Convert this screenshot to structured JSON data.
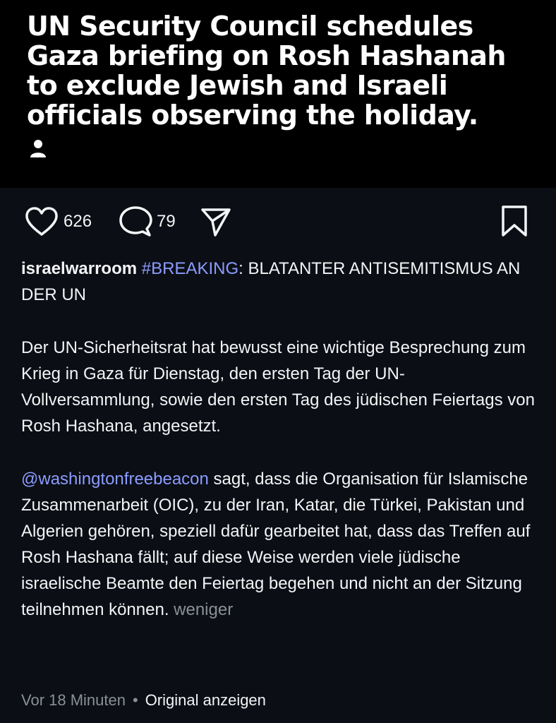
{
  "image": {
    "headline": "UN Security Council schedules Gaza briefing on Rosh Hashanah to exclude Jewish and Israeli officials observing the holiday."
  },
  "actions": {
    "likes": "626",
    "comments": "79"
  },
  "post": {
    "username": "israelwarroom",
    "hashtag": "#BREAKING",
    "headline_rest": ": BLATANTER ANTISEMITISMUS AN DER UN",
    "paragraph1": "Der UN-Sicherheitsrat hat bewusst eine wichtige Besprechung zum Krieg in Gaza für Dienstag, den ersten Tag der UN-Vollversammlung, sowie den ersten Tag des jüdischen Feiertags von Rosh Hashana, angesetzt.",
    "mention": "@washingtonfreebeacon",
    "paragraph2_rest": " sagt, dass die Organisation für Islamische Zusammenarbeit (OIC), zu der Iran, Katar, die Türkei, Pakistan und Algerien gehören, speziell dafür gearbeitet hat, dass das Treffen auf Rosh Hashana fällt; auf diese Weise werden viele jüdische israelische Beamte den Feiertag begehen und nicht an der Sitzung teilnehmen können.",
    "less_label": "weniger"
  },
  "meta": {
    "time": "Vor 18 Minuten",
    "separator": "•",
    "translate_label": "Original anzeigen"
  },
  "colors": {
    "link": "#8b9cff",
    "muted": "#8a8f99",
    "background": "#0b0e14"
  },
  "icons": [
    "heart-icon",
    "comment-icon",
    "send-icon",
    "bookmark-icon",
    "user-tag-icon"
  ]
}
